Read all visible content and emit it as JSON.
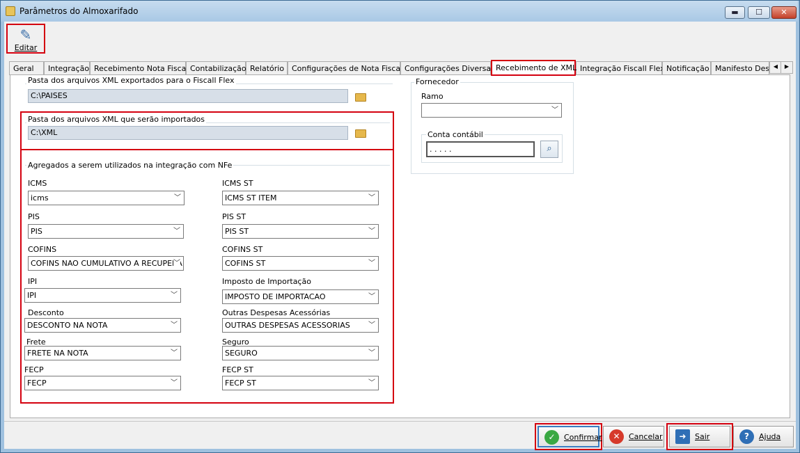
{
  "window": {
    "title": "Parâmetros do Almoxarifado",
    "controls": {
      "minimize": "▬",
      "maximize": "☐",
      "close": "✕"
    }
  },
  "toolbar": {
    "edit_label": "Editar",
    "edit_icon": "edit-document-icon"
  },
  "tabs": [
    {
      "label": "Geral",
      "active": false
    },
    {
      "label": "Integração",
      "active": false
    },
    {
      "label": "Recebimento Nota Fiscal",
      "active": false
    },
    {
      "label": "Contabilização",
      "active": false
    },
    {
      "label": "Relatório",
      "active": false
    },
    {
      "label": "Configurações de Nota Fiscal",
      "active": false
    },
    {
      "label": "Configurações Diversas",
      "active": false
    },
    {
      "label": "Recebimento de XML",
      "active": true
    },
    {
      "label": "Integração Fiscall Flex",
      "active": false
    },
    {
      "label": "Notificação",
      "active": false
    },
    {
      "label": "Manifesto Dest",
      "active": false
    }
  ],
  "tab_scroll": {
    "left": "◀",
    "right": "▶"
  },
  "export_folder": {
    "label": "Pasta dos arquivos XML exportados para o Fiscall Flex",
    "value": "C:\\PAISES"
  },
  "import_folder": {
    "label": "Pasta dos arquivos XML que serão importados",
    "value": "C:\\XML"
  },
  "aggregates": {
    "title": "Agregados a serem utilizados na integração com NFe",
    "fields": [
      {
        "label": "ICMS",
        "value": "icms"
      },
      {
        "label": "ICMS ST",
        "value": "ICMS ST ITEM"
      },
      {
        "label": "PIS",
        "value": "PIS"
      },
      {
        "label": "PIS ST",
        "value": "PIS ST"
      },
      {
        "label": "COFINS",
        "value": "COFINS NAO CUMULATIVO A RECUPERA"
      },
      {
        "label": "COFINS ST",
        "value": "COFINS ST"
      },
      {
        "label": "IPI",
        "value": "IPI"
      },
      {
        "label": "Imposto de Importação",
        "value": "IMPOSTO DE IMPORTACAO"
      },
      {
        "label": "Desconto",
        "value": "DESCONTO NA NOTA"
      },
      {
        "label": "Outras Despesas Acessórias",
        "value": "OUTRAS DESPESAS ACESSORIAS"
      },
      {
        "label": "Frete",
        "value": "FRETE NA NOTA"
      },
      {
        "label": "Seguro",
        "value": "SEGURO"
      },
      {
        "label": "FECP",
        "value": "FECP"
      },
      {
        "label": "FECP ST",
        "value": "FECP ST"
      }
    ]
  },
  "supplier": {
    "title": "Fornecedor",
    "branch_label": "Ramo",
    "branch_value": "",
    "account_label": "Conta contábil",
    "account_value": ". . . . ."
  },
  "footer": {
    "confirm": "Confirmar",
    "cancel": "Cancelar",
    "exit": "Sair",
    "help": "Ajuda"
  },
  "colors": {
    "highlight": "#d4000f",
    "confirm_icon": "#3aa843",
    "cancel_icon": "#d63a2b",
    "exit_icon": "#2f6fb6",
    "help_icon": "#2f6fb6"
  }
}
